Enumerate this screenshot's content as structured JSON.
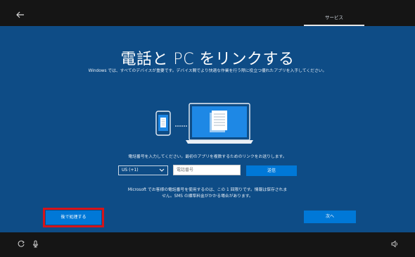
{
  "header": {
    "tab_label": "サービス"
  },
  "main": {
    "title": "電話と PC をリンクする",
    "subtitle": "Windows では、すべてのデバイスが重要です。デバイス間でより快適な作業を行う際に役立つ優れたアプリを入手してください。",
    "instruction": "電話番号を入力してください。最初のアプリを複数するためのリンクをお送りします。",
    "country_value": "US (+1)",
    "phone_placeholder": "電話番号",
    "send_label": "送信",
    "disclaimer_line1": "Microsoft でお客様の電話番号を使用するのは、この 1 回限りです。情報は保存されま",
    "disclaimer_line2": "せん。SMS の標準料金がかかる場合があります。"
  },
  "footer": {
    "later_label": "後で処理する",
    "next_label": "次へ"
  },
  "icons": {
    "back": "back-arrow-icon",
    "accessibility": "accessibility-icon",
    "microphone": "microphone-icon",
    "volume": "volume-icon"
  },
  "colors": {
    "background": "#0e4c86",
    "accent": "#0078d7",
    "bar": "#151515",
    "highlight_box": "#d5141a"
  }
}
